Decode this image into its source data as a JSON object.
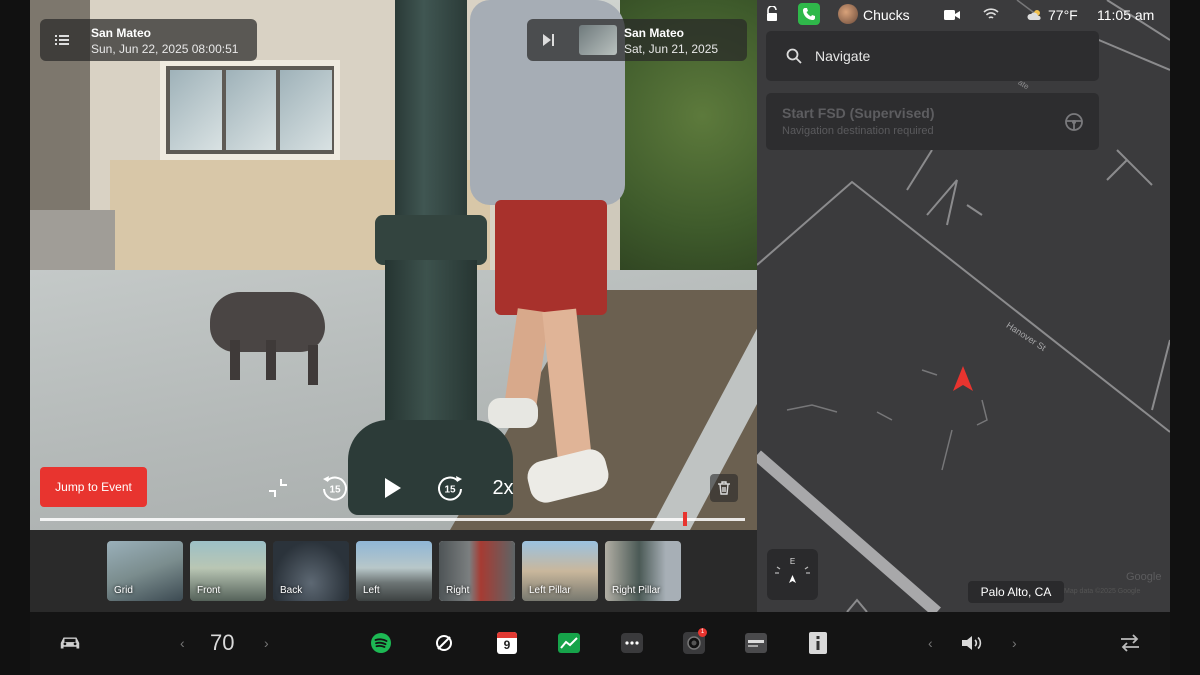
{
  "viewer": {
    "left_tag": {
      "location": "San Mateo",
      "datetime": "Sun, Jun 22, 2025 08:00:51",
      "icon": "list-icon"
    },
    "right_tag": {
      "location": "San Mateo",
      "date": "Sat, Jun 21, 2025",
      "icon": "skip-next-icon"
    },
    "jump_label": "Jump to Event",
    "skip_back": "15",
    "skip_forward": "15",
    "speed": "2x",
    "progress": 0.915
  },
  "cameras": [
    {
      "label": "Grid",
      "active": false
    },
    {
      "label": "Front",
      "active": false
    },
    {
      "label": "Back",
      "active": false
    },
    {
      "label": "Left",
      "active": false
    },
    {
      "label": "Right",
      "active": true
    },
    {
      "label": "Left Pillar",
      "active": false
    },
    {
      "label": "Right Pillar",
      "active": false
    }
  ],
  "status_bar": {
    "profile_name": "Chucks",
    "temperature": "77°F",
    "time": "11:05 am",
    "icons": [
      "lock-icon",
      "phone-icon",
      "camera-icon",
      "wifi-icon",
      "weather-icon"
    ]
  },
  "map": {
    "search_placeholder": "Navigate",
    "fsd_title": "Start FSD (Supervised)",
    "fsd_subtitle": "Navigation destination required",
    "street_label": "Hanover St",
    "street_label_2": "ate",
    "compass": "E",
    "location_chip": "Palo Alto, CA",
    "attribution": "Google",
    "map_data": "Map data ©2025 Google"
  },
  "dock": {
    "temperature": "70",
    "prev": "‹",
    "next": "›",
    "vol_prev": "‹",
    "vol_next": "›",
    "calendar_day": "9",
    "camera_badge": "1"
  },
  "colors": {
    "accent_red": "#e8342f",
    "spotify_green": "#1db954",
    "phone_green": "#2fb84a"
  }
}
